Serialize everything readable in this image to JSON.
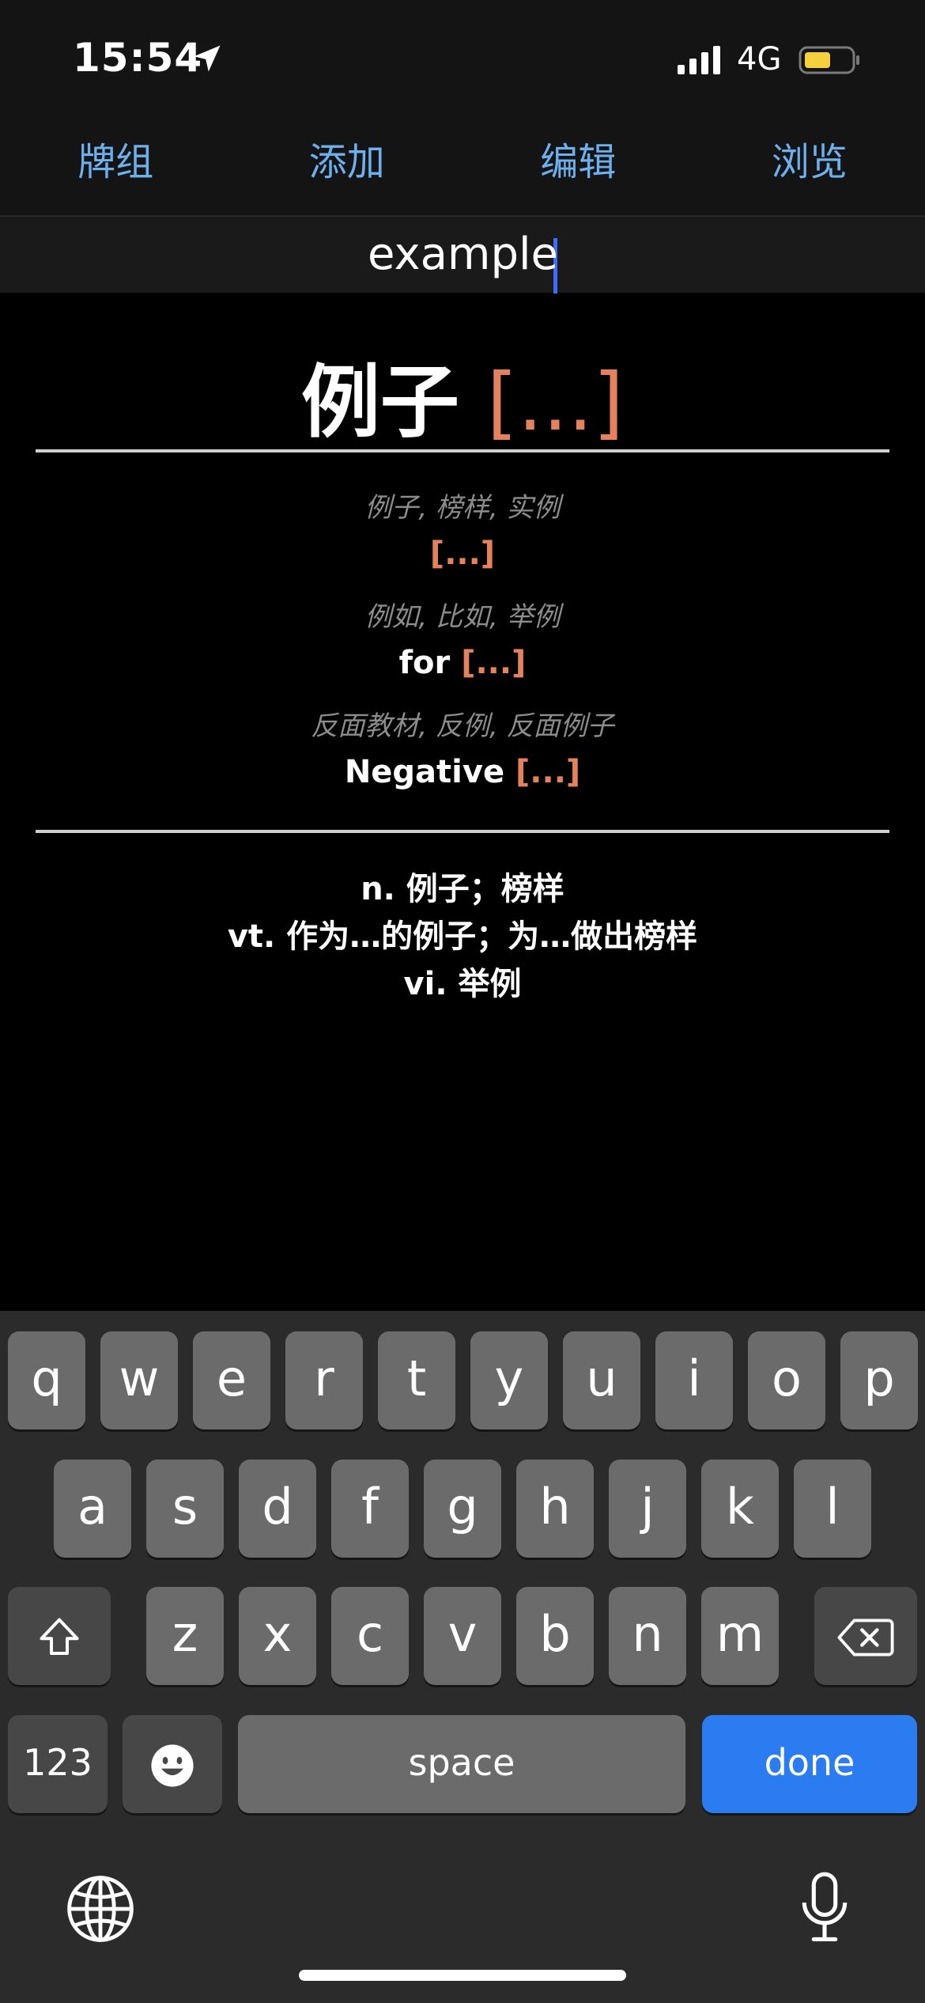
{
  "status_bar": {
    "time": "15:54",
    "network": "4G",
    "battery_color": "#f5d03c",
    "icons": [
      "location-arrow-icon",
      "signal-bars-icon",
      "battery-icon"
    ]
  },
  "nav": {
    "items": [
      {
        "label": "牌组"
      },
      {
        "label": "添加"
      },
      {
        "label": "编辑"
      },
      {
        "label": "浏览"
      }
    ],
    "color": "#6cb1ee"
  },
  "search_field": {
    "value": "example"
  },
  "card": {
    "headword": "例子",
    "cloze": "[...]",
    "cloze_color": "#e5825d",
    "examples": [
      {
        "cn": "例子, 榜样, 实例",
        "en": ""
      },
      {
        "cn": "例如, 比如, 举例",
        "en": "for"
      },
      {
        "cn": "反面教材, 反例, 反面例子",
        "en": "Negative"
      }
    ],
    "definitions": [
      "n. 例子；榜样",
      "vt. 作为…的例子；为…做出榜样",
      "vi. 举例"
    ]
  },
  "keyboard": {
    "row1": [
      "q",
      "w",
      "e",
      "r",
      "t",
      "y",
      "u",
      "i",
      "o",
      "p"
    ],
    "row2": [
      "a",
      "s",
      "d",
      "f",
      "g",
      "h",
      "j",
      "k",
      "l"
    ],
    "row3": [
      "z",
      "x",
      "c",
      "v",
      "b",
      "n",
      "m"
    ],
    "numbers_label": "123",
    "space_label": "space",
    "done_label": "done",
    "done_color": "#2a7cf0",
    "icons": [
      "shift-icon",
      "backspace-icon",
      "emoji-icon",
      "globe-icon",
      "microphone-icon"
    ]
  }
}
